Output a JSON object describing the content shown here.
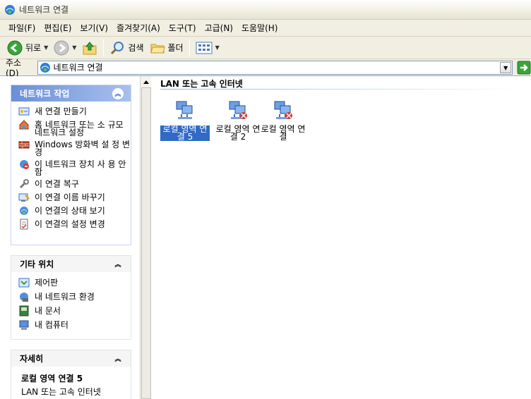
{
  "window": {
    "title": "네트워크 연결"
  },
  "menu": {
    "items": [
      "파일(F)",
      "편집(E)",
      "보기(V)",
      "즐겨찾기(A)",
      "도구(T)",
      "고급(N)",
      "도움말(H)"
    ]
  },
  "toolbar": {
    "back_label": "뒤로",
    "search_label": "검색",
    "folders_label": "폴더"
  },
  "address": {
    "label": "주소(D)",
    "value": "네트워크 연결"
  },
  "left": {
    "network_tasks": {
      "title": "네트워크 작업",
      "items": [
        {
          "label": "새 연결 만들기",
          "icon": "new-connection-icon"
        },
        {
          "label": "홈 네트워크 또는 소 규모 네트워크 설정",
          "icon": "home-network-icon"
        },
        {
          "label": "Windows 방화벽 설 정 변경",
          "icon": "firewall-icon"
        },
        {
          "label": "이 네트워크 장치 사 용 안 함",
          "icon": "disable-device-icon"
        },
        {
          "label": "이 연결 복구",
          "icon": "repair-icon"
        },
        {
          "label": "이 연결 이름 바꾸기",
          "icon": "rename-icon"
        },
        {
          "label": "이 연결의 상태 보기",
          "icon": "status-icon"
        },
        {
          "label": "이 연결의 설정 변경",
          "icon": "settings-icon"
        }
      ]
    },
    "other_places": {
      "title": "기타 위치",
      "items": [
        {
          "label": "제어판",
          "icon": "control-panel-icon"
        },
        {
          "label": "내 네트워크 환경",
          "icon": "my-network-icon"
        },
        {
          "label": "내 문서",
          "icon": "my-documents-icon"
        },
        {
          "label": "내 컴퓨터",
          "icon": "my-computer-icon"
        }
      ]
    },
    "details": {
      "title": "자세히",
      "name": "로컬 영역 연결 5",
      "type": "LAN 또는 고속 인터넷"
    }
  },
  "content": {
    "group_header": "LAN 또는 고속 인터넷",
    "connections": [
      {
        "label": "로컬 영역 연결 5",
        "selected": true
      },
      {
        "label": "로컬 영역 연결 2",
        "selected": false
      },
      {
        "label": "로컬 영역 연결",
        "selected": false
      }
    ]
  }
}
